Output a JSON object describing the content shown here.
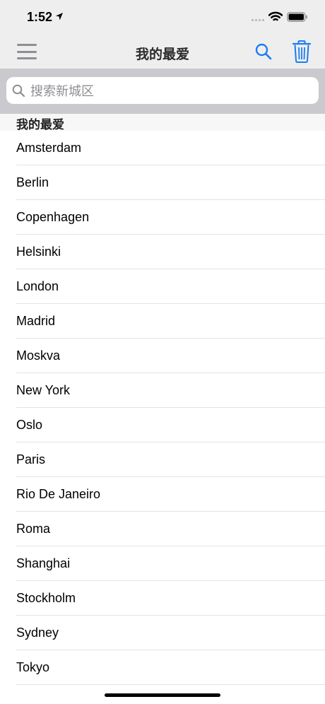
{
  "status_bar": {
    "time": "1:52"
  },
  "nav": {
    "title": "我的最爱"
  },
  "search": {
    "placeholder": "搜索新城区"
  },
  "section": {
    "header": "我的最爱"
  },
  "cities": [
    "Amsterdam",
    "Berlin",
    "Copenhagen",
    "Helsinki",
    "London",
    "Madrid",
    "Moskva",
    "New York",
    "Oslo",
    "Paris",
    "Rio De Janeiro",
    "Roma",
    "Shanghai",
    "Stockholm",
    "Sydney",
    "Tokyo"
  ],
  "colors": {
    "accent": "#1a7df1",
    "nav_background": "#eeeeef",
    "search_band": "#c9c9ce",
    "icon_gray": "#8e8e93"
  },
  "icons": {
    "menu": "hamburger-icon",
    "search": "magnifier-icon",
    "trash": "trash-icon",
    "location": "location-arrow-icon",
    "wifi": "wifi-icon",
    "battery": "battery-icon",
    "signal": "cellular-signal-icon"
  }
}
